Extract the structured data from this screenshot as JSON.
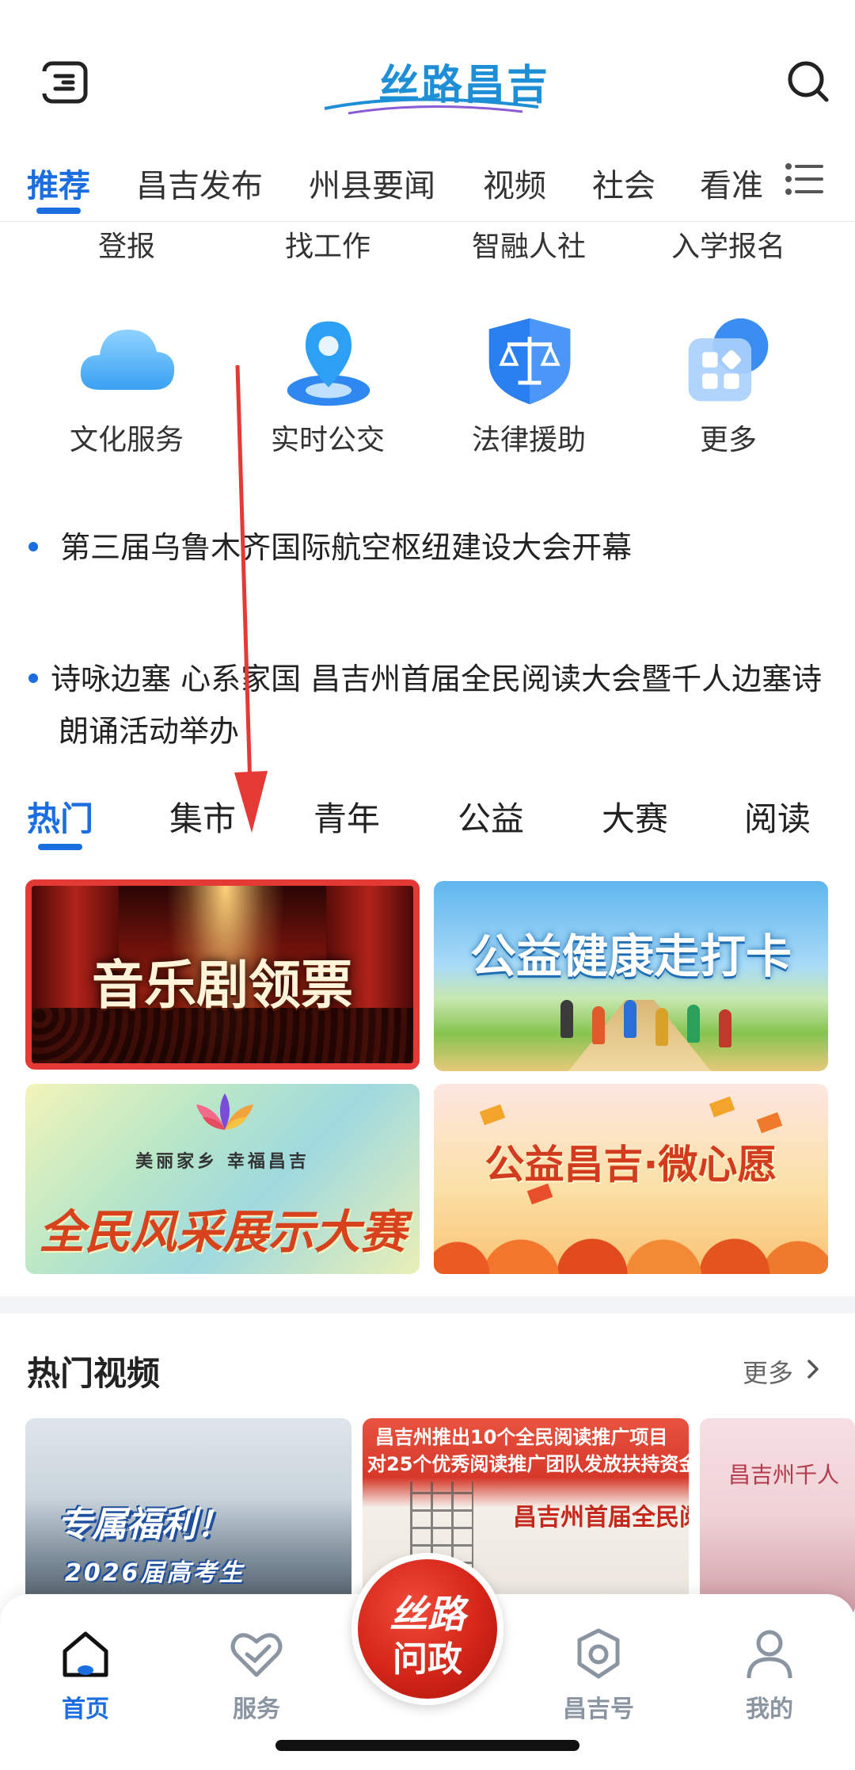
{
  "app": {
    "logo_text": "丝路昌吉"
  },
  "colors": {
    "accent": "#1a6ee0",
    "highlight_border": "#e53935",
    "center_button": "#d42519"
  },
  "top_tabs": [
    {
      "label": "推荐",
      "active": true
    },
    {
      "label": "昌吉发布"
    },
    {
      "label": "州县要闻"
    },
    {
      "label": "视频"
    },
    {
      "label": "社会"
    },
    {
      "label": "看准"
    }
  ],
  "services_row1": [
    "登报",
    "找工作",
    "智融人社",
    "入学报名"
  ],
  "services_row2": [
    {
      "label": "文化服务",
      "icon": "cloud-icon"
    },
    {
      "label": "实时公交",
      "icon": "location-pin-icon"
    },
    {
      "label": "法律援助",
      "icon": "justice-scale-icon"
    },
    {
      "label": "更多",
      "icon": "grid-more-icon"
    }
  ],
  "news": [
    {
      "title": "第三届乌鲁木齐国际航空枢纽建设大会开幕"
    },
    {
      "title": "诗咏边塞 心系家国 昌吉州首届全民阅读大会暨千人边塞诗朗诵活动举办"
    }
  ],
  "sub_tabs": [
    {
      "label": "热门",
      "active": true
    },
    {
      "label": "集市"
    },
    {
      "label": "青年"
    },
    {
      "label": "公益"
    },
    {
      "label": "大赛"
    },
    {
      "label": "阅读"
    }
  ],
  "banners": [
    {
      "title": "音乐剧领票"
    },
    {
      "title": "公益健康走打卡"
    },
    {
      "title": "全民风采展示大赛",
      "slogan": "美丽家乡  幸福昌吉"
    },
    {
      "title": "公益昌吉·微心愿"
    }
  ],
  "hot_videos": {
    "title": "热门视频",
    "more_label": "更多",
    "items": [
      {
        "line1": "专属福利！",
        "line2": "2026届高考生"
      },
      {
        "line1": "昌吉州推出10个全民阅读推广项目",
        "line2": "对25个优秀阅读推广团队发放扶持资金",
        "line3": "昌吉州首届全民阅"
      },
      {
        "line1": "昌吉州千人"
      }
    ]
  },
  "bottom_nav": [
    {
      "label": "首页",
      "icon": "home-icon",
      "active": true
    },
    {
      "label": "服务",
      "icon": "service-heart-icon"
    },
    {
      "label": "昌吉号",
      "icon": "gear-badge-icon"
    },
    {
      "label": "我的",
      "icon": "profile-icon"
    }
  ],
  "center_button": {
    "line1": "丝路",
    "line2": "问政"
  }
}
